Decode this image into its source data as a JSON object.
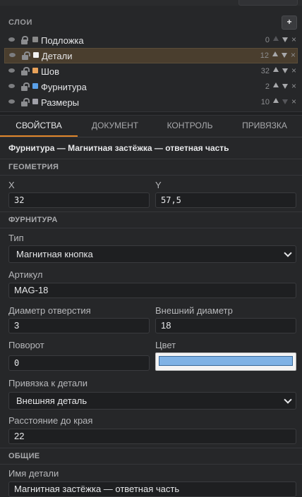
{
  "layers": {
    "title": "СЛОИ",
    "add_label": "+",
    "items": [
      {
        "name": "Подложка",
        "count": "0",
        "color": "#8a8a8a",
        "locked": true,
        "selected": false
      },
      {
        "name": "Детали",
        "count": "12",
        "color": "#f2f2f2",
        "locked": false,
        "selected": true
      },
      {
        "name": "Шов",
        "count": "32",
        "color": "#e8a25a",
        "locked": false,
        "selected": false
      },
      {
        "name": "Фурнитура",
        "count": "2",
        "color": "#5aa0e8",
        "locked": false,
        "selected": false
      },
      {
        "name": "Размеры",
        "count": "10",
        "color": "#a0a0a8",
        "locked": false,
        "selected": false
      }
    ],
    "close_symbol": "×"
  },
  "tabs": [
    {
      "label": "СВОЙСТВА",
      "active": true
    },
    {
      "label": "ДОКУМЕНТ",
      "active": false
    },
    {
      "label": "КОНТРОЛЬ",
      "active": false
    },
    {
      "label": "ПРИВЯЗКА",
      "active": false
    }
  ],
  "properties": {
    "object_title": "Фурнитура — Магнитная застёжка — ответная часть",
    "geometry": {
      "section": "ГЕОМЕТРИЯ",
      "x_label": "X",
      "x_value": "32",
      "y_label": "Y",
      "y_value": "57,5"
    },
    "hardware": {
      "section": "ФУРНИТУРА",
      "type_label": "Тип",
      "type_value": "Магнитная кнопка",
      "article_label": "Артикул",
      "article_value": "MAG-18",
      "hole_label": "Диаметр отверстия",
      "hole_value": "3",
      "outer_label": "Внешний диаметр",
      "outer_value": "18",
      "rotation_label": "Поворот",
      "rotation_value": "0",
      "color_label": "Цвет",
      "color_value": "#7fb2e5",
      "binding_label": "Привязка к детали",
      "binding_value": "Внешняя деталь",
      "edge_label": "Расстояние до края",
      "edge_value": "22"
    },
    "general": {
      "section": "ОБЩИЕ",
      "name_label": "Имя детали",
      "name_value": "Магнитная застёжка — ответная часть"
    }
  },
  "colors": {
    "accent": "#e0862a",
    "background": "#262729",
    "selected_row": "#4a3e2e"
  }
}
